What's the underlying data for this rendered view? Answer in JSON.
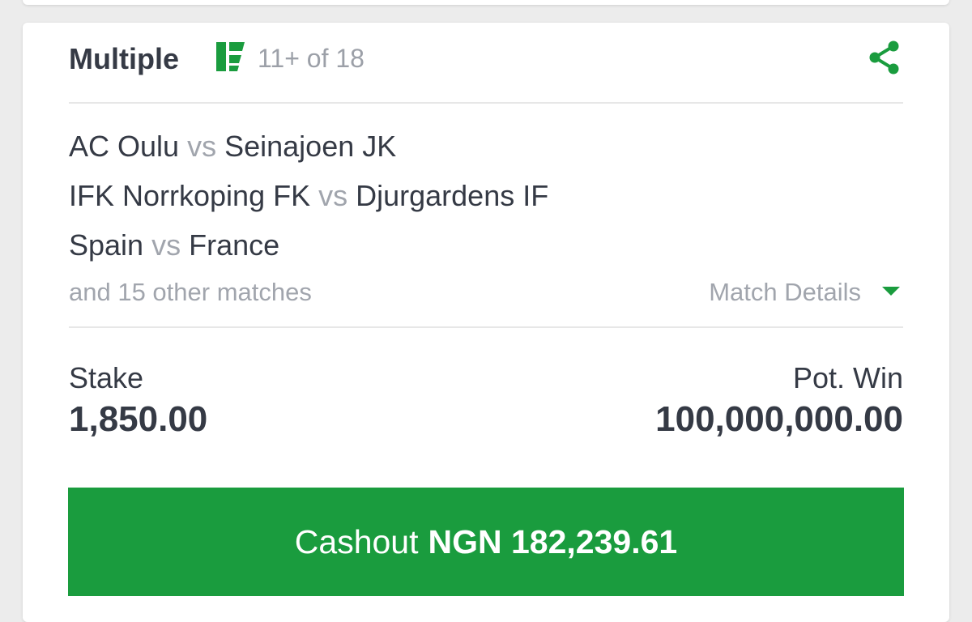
{
  "bet": {
    "type": "Multiple",
    "selection_count": "11+ of 18",
    "matches": [
      {
        "home": "AC Oulu",
        "vs": "vs",
        "away": "Seinajoen JK"
      },
      {
        "home": "IFK Norrkoping FK",
        "vs": "vs",
        "away": "Djurgardens IF"
      },
      {
        "home": "Spain",
        "vs": "vs",
        "away": "France"
      }
    ],
    "other_matches": "and 15 other matches",
    "match_details_label": "Match Details",
    "stake_label": "Stake",
    "stake_value": "1,850.00",
    "potwin_label": "Pot. Win",
    "potwin_value": "100,000,000.00",
    "cashout_label": "Cashout",
    "cashout_amount": "NGN 182,239.61"
  },
  "icons": {
    "logo": "flex-logo-icon",
    "share": "share-icon",
    "match_details": "caret-down-icon"
  },
  "colors": {
    "brand_green": "#1a9c3e",
    "text_dark": "#353a45",
    "text_muted": "#a1a5ad"
  }
}
